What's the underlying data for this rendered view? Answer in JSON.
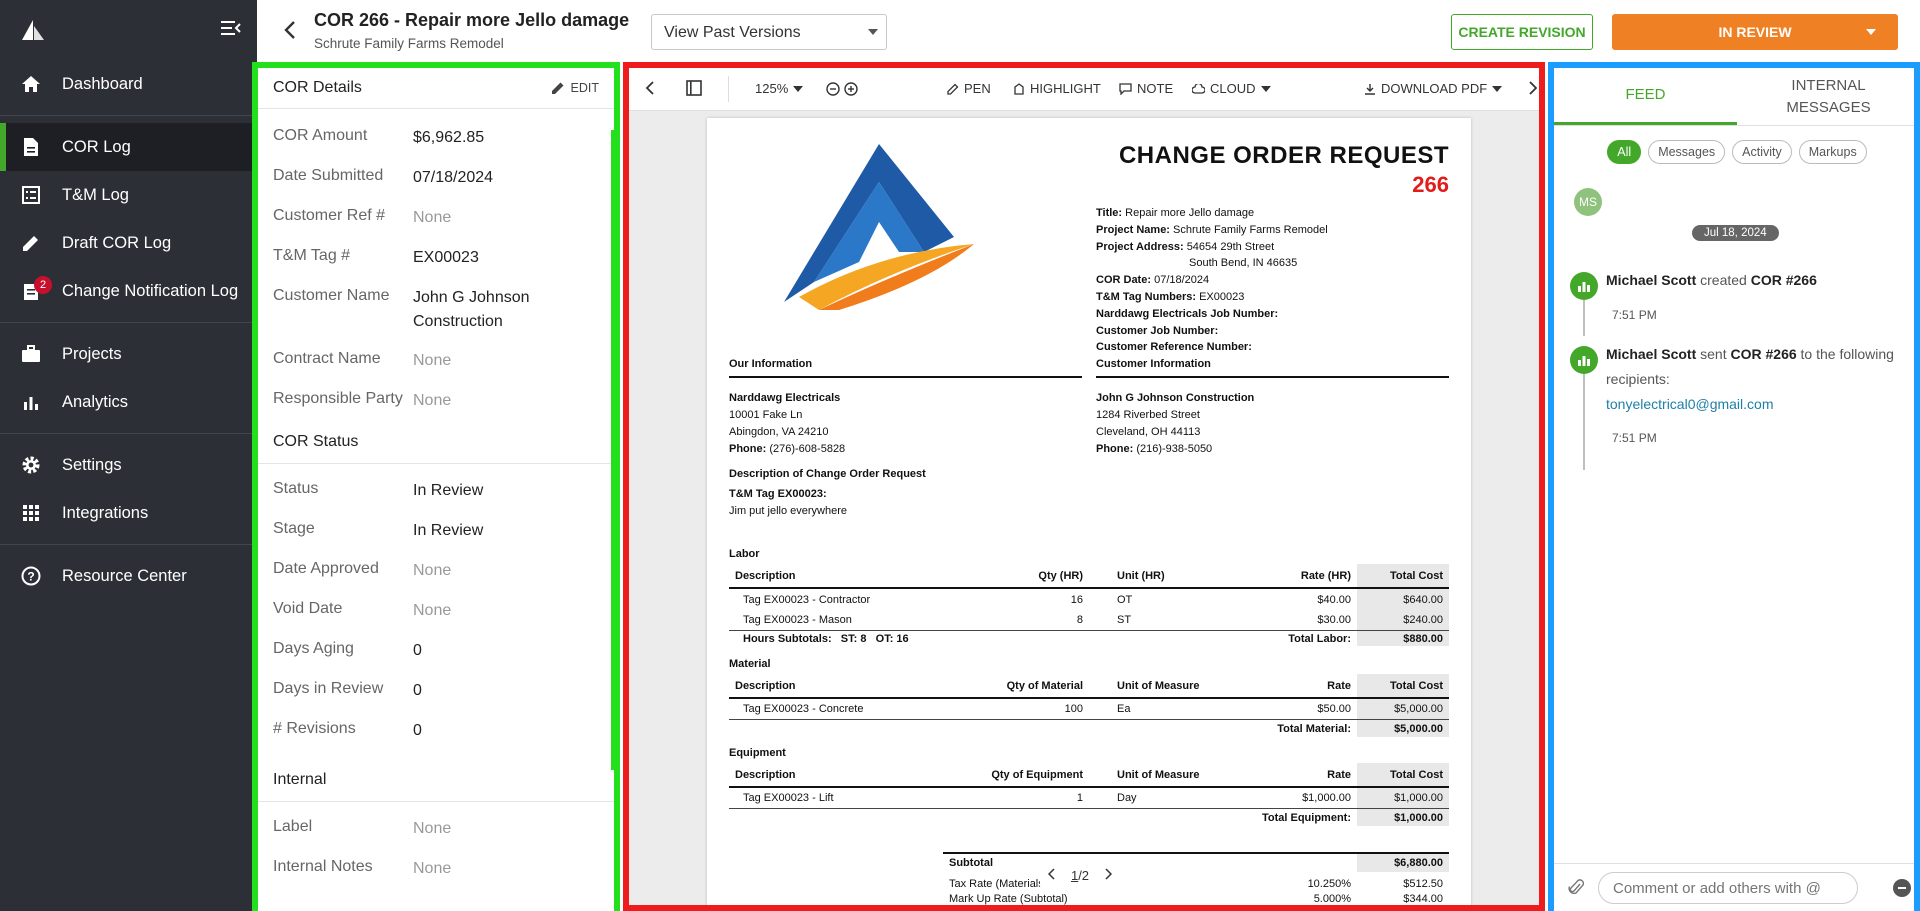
{
  "sidebar": {
    "items": [
      {
        "label": "Dashboard",
        "icon": "home-icon"
      },
      {
        "label": "COR Log",
        "icon": "document-icon",
        "active": true
      },
      {
        "label": "T&M Log",
        "icon": "list-icon"
      },
      {
        "label": "Draft COR Log",
        "icon": "pencil-icon"
      },
      {
        "label": "Change Notification Log",
        "icon": "notification-icon",
        "badge": "2"
      },
      {
        "label": "Projects",
        "icon": "briefcase-icon"
      },
      {
        "label": "Analytics",
        "icon": "bar-chart-icon"
      },
      {
        "label": "Settings",
        "icon": "gear-icon"
      },
      {
        "label": "Integrations",
        "icon": "grid-icon"
      },
      {
        "label": "Resource Center",
        "icon": "help-icon"
      }
    ]
  },
  "header": {
    "title": "COR 266 - Repair more Jello damage",
    "subtitle": "Schrute Family Farms Remodel",
    "versions_label": "View Past Versions",
    "create_revision": "CREATE REVISION",
    "status_button": "IN REVIEW"
  },
  "details": {
    "title": "COR Details",
    "edit": "EDIT",
    "rows": [
      {
        "label": "COR Amount",
        "value": "$6,962.85"
      },
      {
        "label": "Date Submitted",
        "value": "07/18/2024"
      },
      {
        "label": "Customer Ref #",
        "value": "None"
      },
      {
        "label": "T&M Tag #",
        "value": "EX00023"
      },
      {
        "label": "Customer Name",
        "value": "John G Johnson Construction"
      },
      {
        "label": "Contract Name",
        "value": "None"
      },
      {
        "label": "Responsible Party",
        "value": "None"
      }
    ],
    "status_title": "COR Status",
    "status_rows": [
      {
        "label": "Status",
        "value": "In Review"
      },
      {
        "label": "Stage",
        "value": "In Review"
      },
      {
        "label": "Date Approved",
        "value": "None"
      },
      {
        "label": "Void Date",
        "value": "None"
      },
      {
        "label": "Days Aging",
        "value": "0"
      },
      {
        "label": "Days in Review",
        "value": "0"
      },
      {
        "label": "# Revisions",
        "value": "0"
      }
    ],
    "internal_title": "Internal",
    "internal_rows": [
      {
        "label": "Label",
        "value": "None"
      },
      {
        "label": "Internal Notes",
        "value": "None"
      }
    ]
  },
  "viewer": {
    "zoom": "125%",
    "pen": "PEN",
    "highlight": "HIGHLIGHT",
    "note": "NOTE",
    "cloud": "CLOUD",
    "download": "DOWNLOAD PDF",
    "page": "1",
    "pages": "/2"
  },
  "doc": {
    "heading": "CHANGE ORDER REQUEST",
    "number": "266",
    "meta": [
      {
        "k": "Title:",
        "v": "Repair more Jello damage"
      },
      {
        "k": "Project Name:",
        "v": "Schrute Family Farms Remodel"
      },
      {
        "k": "Project Address:",
        "v": "54654 29th Street"
      },
      {
        "k": "",
        "v": "South Bend, IN 46635"
      },
      {
        "k": "COR Date:",
        "v": "07/18/2024"
      },
      {
        "k": "T&M Tag Numbers:",
        "v": "EX00023"
      },
      {
        "k": "Narddawg Electricals Job Number:",
        "v": ""
      },
      {
        "k": "Customer Job Number:",
        "v": ""
      },
      {
        "k": "Customer Reference Number:",
        "v": ""
      }
    ],
    "our_info_title": "Our Information",
    "our_info": {
      "name": "Narddawg Electricals",
      "line1": "10001 Fake Ln",
      "line2": "Abingdon, VA 24210",
      "phone_label": "Phone:",
      "phone": "(276)-608-5828"
    },
    "cust_info_title": "Customer Information",
    "cust_info": {
      "name": "John G Johnson Construction",
      "line1": "1284 Riverbed Street",
      "line2": "Cleveland, OH 44113",
      "phone_label": "Phone:",
      "phone": "(216)-938-5050"
    },
    "desc_title": "Description of Change Order Request",
    "desc_tag": "T&M Tag EX00023:",
    "desc_text": "Jim put jello everywhere",
    "labor": {
      "title": "Labor",
      "headers": [
        "Description",
        "Qty (HR)",
        "Unit (HR)",
        "Rate (HR)",
        "Total Cost"
      ],
      "rows": [
        [
          "Tag EX00023 - Contractor",
          "16",
          "OT",
          "$40.00",
          "$640.00"
        ],
        [
          "Tag EX00023 - Mason",
          "8",
          "ST",
          "$30.00",
          "$240.00"
        ]
      ],
      "subtotal_label": "Hours Subtotals:",
      "st": "ST: 8",
      "ot": "OT: 16",
      "total_label": "Total Labor:",
      "total": "$880.00"
    },
    "material": {
      "title": "Material",
      "headers": [
        "Description",
        "Qty of Material",
        "Unit of Measure",
        "Rate",
        "Total Cost"
      ],
      "rows": [
        [
          "Tag EX00023 - Concrete",
          "100",
          "Ea",
          "$50.00",
          "$5,000.00"
        ]
      ],
      "total_label": "Total Material:",
      "total": "$5,000.00"
    },
    "equipment": {
      "title": "Equipment",
      "headers": [
        "Description",
        "Qty of Equipment",
        "Unit of Measure",
        "Rate",
        "Total Cost"
      ],
      "rows": [
        [
          "Tag EX00023 - Lift",
          "1",
          "Day",
          "$1,000.00",
          "$1,000.00"
        ]
      ],
      "total_label": "Total Equipment:",
      "total": "$1,000.00"
    },
    "summary": {
      "subtotal_label": "Subtotal",
      "subtotal": "$6,880.00",
      "tax_label": "Tax Rate (Materials)",
      "tax_rate": "10.250%",
      "tax": "$512.50",
      "markup_label": "Mark Up Rate (Subtotal)",
      "markup_rate": "5.000%",
      "markup": "$344.00"
    }
  },
  "feed": {
    "tab_feed": "FEED",
    "tab_internal": "INTERNAL MESSAGES",
    "chips": [
      "All",
      "Messages",
      "Activity",
      "Markups"
    ],
    "avatar": "MS",
    "date": "Jul 18, 2024",
    "a1_user": "Michael Scott",
    "a1_verb": "created",
    "a1_obj": "COR #266",
    "a1_time": "7:51 PM",
    "a2_user": "Michael Scott",
    "a2_verb": "sent",
    "a2_obj": "COR #266",
    "a2_rest": "to the following recipients:",
    "a2_email": "tonyelectrical0@gmail.com",
    "a2_time": "7:51 PM",
    "comment_placeholder": "Comment or add others with @"
  }
}
